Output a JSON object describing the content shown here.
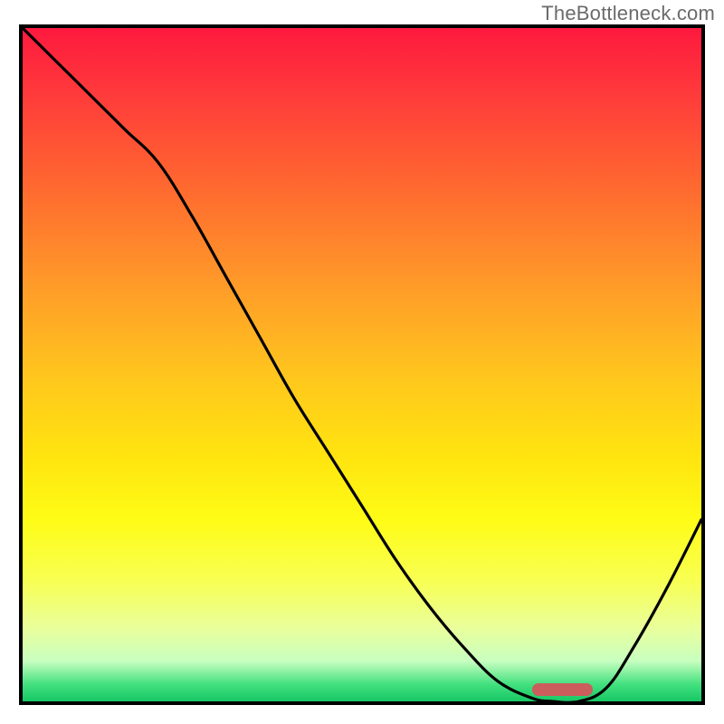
{
  "watermark": "TheBottleneck.com",
  "colors": {
    "frame": "#000000",
    "curve": "#000000",
    "marker": "#cb5d5c",
    "gradient_top": "#fe193e",
    "gradient_bottom": "#17c765"
  },
  "chart_data": {
    "type": "line",
    "title": "",
    "xlabel": "",
    "ylabel": "",
    "xlim": [
      0,
      100
    ],
    "ylim": [
      0,
      100
    ],
    "x": [
      0,
      5,
      10,
      15,
      20,
      25,
      30,
      35,
      40,
      45,
      50,
      55,
      60,
      65,
      70,
      75,
      78,
      82,
      86,
      90,
      95,
      100
    ],
    "values": [
      100,
      95,
      90,
      85,
      80,
      72,
      63,
      54,
      45,
      37,
      29,
      21,
      14,
      8,
      3,
      0.5,
      0,
      0,
      2,
      8,
      17,
      27
    ],
    "marker": {
      "x_start": 75,
      "x_end": 84,
      "y": 0.5
    },
    "notes": "x and y are normalized 0–100. y is percentage of vertical span from bottom (0) to top (100). Curve is the single black line visible; marker is the short rounded pink-red bar near the bottom. Axes have no ticks or labels."
  }
}
